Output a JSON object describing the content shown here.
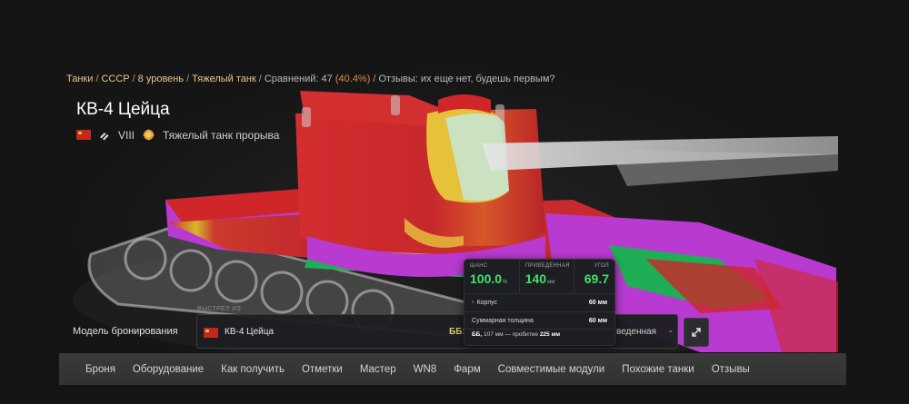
{
  "breadcrumb": {
    "tanks": "Танки",
    "nation": "СССР",
    "tier": "8 уровень",
    "type": "Тяжелый танк",
    "compare_label": "Сравнений: 47",
    "compare_pct": "(40.4%)",
    "reviews_label": "Отзывы:",
    "reviews_text": "их еще нет, будешь первым?"
  },
  "tank": {
    "name": "КВ-4 Цейца",
    "tier": "VIII",
    "role": "Тяжелый танк прорыва",
    "nation_flag": "ussr-flag-icon",
    "class_icon": "heavy-tank-icon",
    "role_icon": "breakthrough-medal-icon"
  },
  "armor_model": {
    "label": "Модель бронирования",
    "shooter_caption": "ВЫСТРЕЛ ИЗ",
    "shooter_name": "КВ-4 Цейца",
    "ammo_short": "ББ:",
    "thickness_mode": "веденная",
    "expand_icon": "expand-arrows-icon"
  },
  "tooltip": {
    "chance_label": "ШАНС",
    "chance_value": "100.0",
    "chance_unit": "%",
    "reduced_label": "ПРИВЕДЁННАЯ",
    "reduced_value": "140",
    "reduced_unit": "мм",
    "angle_label": "УГОЛ",
    "angle_value": "69.7",
    "part_name": "Корпус",
    "part_value": "60 мм",
    "total_label": "Суммарная толщина",
    "total_value": "60 мм",
    "foot_prefix": "ББ,",
    "foot_caliber": "107 мм — пробитие",
    "foot_pen": "225 мм"
  },
  "tabs": [
    "Броня",
    "Оборудование",
    "Как получить",
    "Отметки",
    "Мастер",
    "WN8",
    "Фарм",
    "Совместимые модули",
    "Похожие танки",
    "Отзывы"
  ],
  "colors": {
    "link": "#e9c68a",
    "accent_green": "#41e26b",
    "armor_red": "#d0262a",
    "armor_magenta": "#b83ad0",
    "armor_green": "#1fae55"
  }
}
